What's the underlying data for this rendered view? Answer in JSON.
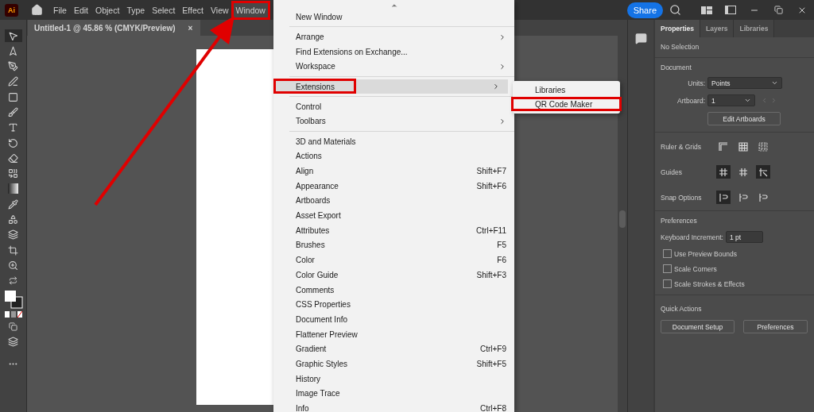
{
  "app_badge": "Ai",
  "menubar": [
    {
      "label": "File",
      "selected": false
    },
    {
      "label": "Edit",
      "selected": false
    },
    {
      "label": "Object",
      "selected": false
    },
    {
      "label": "Type",
      "selected": false
    },
    {
      "label": "Select",
      "selected": false
    },
    {
      "label": "Effect",
      "selected": false
    },
    {
      "label": "View",
      "selected": false
    },
    {
      "label": "Window",
      "selected": true
    }
  ],
  "share_button": "Share",
  "document_tab": {
    "title": "Untitled-1 @ 45.86 % (CMYK/Preview)",
    "close": "×"
  },
  "window_menu": [
    {
      "kind": "item",
      "label": "New Window",
      "selected": false
    },
    {
      "kind": "separator"
    },
    {
      "kind": "item",
      "label": "Arrange",
      "submenu": true,
      "selected": false
    },
    {
      "kind": "item",
      "label": "Find Extensions on Exchange...",
      "selected": false
    },
    {
      "kind": "item",
      "label": "Workspace",
      "submenu": true,
      "selected": false
    },
    {
      "kind": "separator"
    },
    {
      "kind": "item",
      "label": "Extensions",
      "submenu": true,
      "selected": true
    },
    {
      "kind": "separator"
    },
    {
      "kind": "item",
      "label": "Control",
      "selected": false
    },
    {
      "kind": "item",
      "label": "Toolbars",
      "submenu": true,
      "selected": false
    },
    {
      "kind": "separator"
    },
    {
      "kind": "item",
      "label": "3D and Materials",
      "selected": false
    },
    {
      "kind": "item",
      "label": "Actions",
      "selected": false
    },
    {
      "kind": "item",
      "label": "Align",
      "shortcut": "Shift+F7",
      "selected": false
    },
    {
      "kind": "item",
      "label": "Appearance",
      "shortcut": "Shift+F6",
      "selected": false
    },
    {
      "kind": "item",
      "label": "Artboards",
      "selected": false
    },
    {
      "kind": "item",
      "label": "Asset Export",
      "selected": false
    },
    {
      "kind": "item",
      "label": "Attributes",
      "shortcut": "Ctrl+F11",
      "selected": false
    },
    {
      "kind": "item",
      "label": "Brushes",
      "shortcut": "F5",
      "selected": false
    },
    {
      "kind": "item",
      "label": "Color",
      "shortcut": "F6",
      "selected": false
    },
    {
      "kind": "item",
      "label": "Color Guide",
      "shortcut": "Shift+F3",
      "selected": false
    },
    {
      "kind": "item",
      "label": "Comments",
      "selected": false
    },
    {
      "kind": "item",
      "label": "CSS Properties",
      "selected": false
    },
    {
      "kind": "item",
      "label": "Document Info",
      "selected": false
    },
    {
      "kind": "item",
      "label": "Flattener Preview",
      "selected": false
    },
    {
      "kind": "item",
      "label": "Gradient",
      "shortcut": "Ctrl+F9",
      "selected": false
    },
    {
      "kind": "item",
      "label": "Graphic Styles",
      "shortcut": "Shift+F5",
      "selected": false
    },
    {
      "kind": "item",
      "label": "History",
      "selected": false
    },
    {
      "kind": "item",
      "label": "Image Trace",
      "selected": false
    },
    {
      "kind": "item",
      "label": "Info",
      "shortcut": "Ctrl+F8",
      "selected": false
    }
  ],
  "extensions_submenu": [
    {
      "label": "Libraries",
      "selected": false
    },
    {
      "label": "QR Code Maker",
      "selected": true
    }
  ],
  "panel_tabs": [
    {
      "label": "Properties",
      "selected": true
    },
    {
      "label": "Layers",
      "selected": false
    },
    {
      "label": "Libraries",
      "selected": false
    }
  ],
  "selection_status": "No Selection",
  "document": {
    "heading": "Document",
    "units_label": "Units:",
    "units_value": "Points",
    "artboard_label": "Artboard:",
    "artboard_value": "1",
    "edit_button": "Edit Artboards"
  },
  "ruler_grids": {
    "label": "Ruler & Grids",
    "tools": [
      {
        "on": false
      },
      {
        "on": false
      },
      {
        "on": false
      }
    ]
  },
  "guides": {
    "label": "Guides",
    "tools": [
      {
        "on": true
      },
      {
        "on": false
      },
      {
        "on": true
      }
    ]
  },
  "snap_options": {
    "label": "Snap Options",
    "tools": [
      {
        "on": true
      },
      {
        "on": false
      },
      {
        "on": false
      }
    ]
  },
  "preferences": {
    "heading": "Preferences",
    "increment_label": "Keyboard Increment:",
    "increment_value": "1 pt",
    "options": [
      {
        "label": "Use Preview Bounds",
        "checked": false
      },
      {
        "label": "Scale Corners",
        "checked": false
      },
      {
        "label": "Scale Strokes & Effects",
        "checked": false
      }
    ]
  },
  "quick_actions": {
    "heading": "Quick Actions",
    "buttons": [
      "Document Setup",
      "Preferences"
    ]
  }
}
